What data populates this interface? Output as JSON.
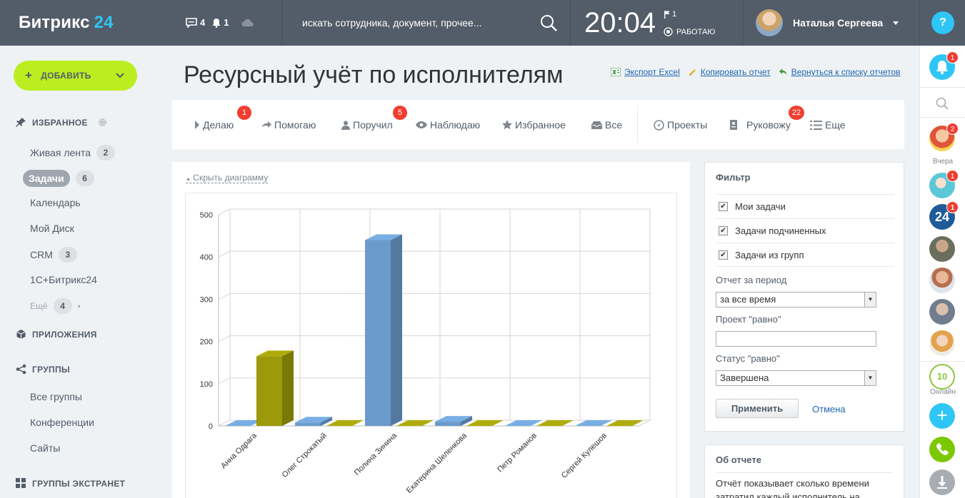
{
  "header": {
    "logo_text": "Битрикс",
    "logo_num": "24",
    "messages_count": "4",
    "notifications_count": "1",
    "search_placeholder": "искать сотрудника, документ, прочее...",
    "clock": "20:04",
    "flag_count": "1",
    "work_status": "РАБОТАЮ",
    "user_name": "Наталья Сергеева",
    "help": "?"
  },
  "sidebar": {
    "add_label": "ДОБАВИТЬ",
    "favorites_title": "ИЗБРАННОЕ",
    "items": [
      {
        "label": "Живая лента",
        "count": "2"
      },
      {
        "label": "Задачи",
        "count": "6"
      },
      {
        "label": "Календарь"
      },
      {
        "label": "Мой Диск"
      },
      {
        "label": "CRM",
        "count": "3"
      },
      {
        "label": "1С+Битрикс24"
      },
      {
        "label": "Ещё",
        "count": "4"
      }
    ],
    "apps_title": "ПРИЛОЖЕНИЯ",
    "groups_title": "ГРУППЫ",
    "group_items": [
      {
        "label": "Все группы"
      },
      {
        "label": "Конференции"
      },
      {
        "label": "Сайты"
      }
    ],
    "extranet_title": "ГРУППЫ ЭКСТРАНЕТ"
  },
  "page": {
    "title": "Ресурсный учёт по исполнителям",
    "links": {
      "export": "Экспорт Excel",
      "copy": "Копировать отчет",
      "back": "Вернуться к списку отчетов"
    }
  },
  "tabs": [
    {
      "label": "Делаю",
      "badge": "1"
    },
    {
      "label": "Помогаю"
    },
    {
      "label": "Поручил",
      "badge": "5"
    },
    {
      "label": "Наблюдаю"
    },
    {
      "label": "Избранное"
    },
    {
      "label": "Все"
    },
    {
      "label": "Проекты"
    },
    {
      "label": "Руковожу",
      "badge": "22"
    },
    {
      "label": "Еще"
    }
  ],
  "chart_toggle": "Скрыть диаграмму",
  "chart_data": {
    "type": "bar",
    "categories": [
      "Анна Одрага",
      "Олег Строкатый",
      "Полина Зинина",
      "Екатерина Шеленкова",
      "Петр Романов",
      "Сергей Кулешов"
    ],
    "series": [
      {
        "values": [
          0,
          8,
          440,
          10,
          0,
          0
        ],
        "color": "#6b9bcc"
      },
      {
        "values": [
          165,
          0,
          0,
          0,
          0,
          0
        ],
        "color": "#9c9a0a"
      }
    ],
    "ylim": [
      0,
      500
    ],
    "yticks": [
      "0",
      "100",
      "200",
      "300",
      "400",
      "500"
    ],
    "grid": true
  },
  "filter": {
    "title": "Фильтр",
    "checks": [
      {
        "label": "Мои задачи",
        "checked": true
      },
      {
        "label": "Задачи подчиненных",
        "checked": true
      },
      {
        "label": "Задачи из групп",
        "checked": true
      }
    ],
    "period_label": "Отчет за период",
    "period_value": "за все время",
    "project_label": "Проект \"равно\"",
    "status_label": "Статус \"равно\"",
    "status_value": "Завершена",
    "apply": "Применить",
    "cancel": "Отмена"
  },
  "about": {
    "title": "Об отчете",
    "text": "Отчёт показывает сколько времени затратил каждый исполнитель на"
  },
  "rightbar": {
    "bell_badge": "1",
    "yesterday_label": "Вчера",
    "chat1_badge": "2",
    "chat2_badge": "1",
    "chat3_badge": "1",
    "chat3_text": "24",
    "online_count": "10",
    "online_label": "Онлайн"
  }
}
